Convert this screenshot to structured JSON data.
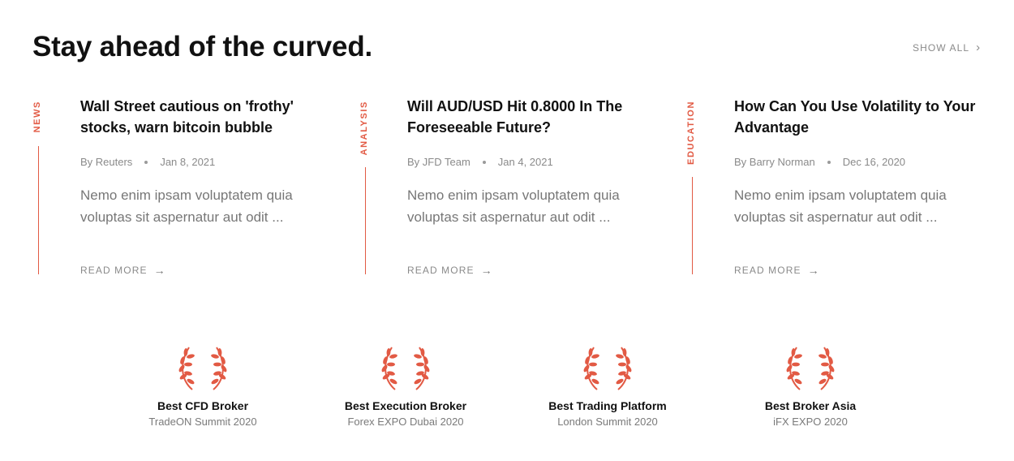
{
  "section": {
    "heading": "Stay ahead of the curved.",
    "show_all_label": "SHOW ALL"
  },
  "articles": [
    {
      "category": "NEWS",
      "title": "Wall Street cautious on 'frothy' stocks, warn bitcoin bubble",
      "author": "By Reuters",
      "date": "Jan 8, 2021",
      "excerpt": "Nemo enim ipsam voluptatem quia voluptas sit aspernatur aut odit ...",
      "read_more": "READ MORE"
    },
    {
      "category": "ANALYSIS",
      "title": "Will AUD/USD Hit 0.8000 In The Foreseeable Future?",
      "author": "By JFD Team",
      "date": "Jan 4, 2021",
      "excerpt": "Nemo enim ipsam voluptatem quia voluptas sit aspernatur aut odit ...",
      "read_more": "READ MORE"
    },
    {
      "category": "EDUCATION",
      "title": "How Can You Use Volatility to Your Advantage",
      "author": "By Barry Norman",
      "date": "Dec 16, 2020",
      "excerpt": "Nemo enim ipsam voluptatem quia voluptas sit aspernatur aut odit ...",
      "read_more": "READ MORE"
    }
  ],
  "awards": [
    {
      "name": "Best CFD Broker",
      "event": "TradeON Summit 2020"
    },
    {
      "name": "Best Execution Broker",
      "event": "Forex EXPO Dubai 2020"
    },
    {
      "name": "Best Trading Platform",
      "event": "London Summit 2020"
    },
    {
      "name": "Best Broker Asia",
      "event": "iFX EXPO 2020"
    }
  ],
  "colors": {
    "accent": "#e25a44",
    "heading": "#111111",
    "muted": "#8a8a8a"
  },
  "icons": {
    "show_all": "chevron-right-icon",
    "read_more": "arrow-right-icon",
    "award": "laurel-wreath-icon"
  }
}
